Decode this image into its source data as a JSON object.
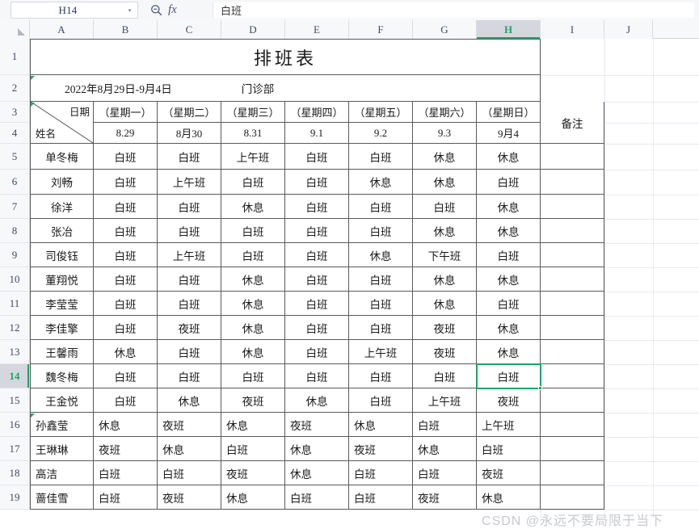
{
  "app": {
    "name_box_value": "H14",
    "name_box_caret": "▾",
    "fx_label": "fx",
    "formula_value": "白班",
    "search_icon": "magnifier-icon"
  },
  "grid": {
    "column_headers": [
      "A",
      "B",
      "C",
      "D",
      "E",
      "F",
      "G",
      "H",
      "I",
      "J"
    ],
    "active_column": "H",
    "row_headers": [
      "1",
      "2",
      "3",
      "4",
      "5",
      "6",
      "7",
      "8",
      "9",
      "10",
      "11",
      "12",
      "13",
      "14",
      "15",
      "16",
      "17",
      "18",
      "19"
    ],
    "active_row": "14"
  },
  "sheet": {
    "title": "排班表",
    "period": "2022年8月29日-9月4日",
    "department": "门诊部",
    "corner_date_label": "日期",
    "corner_name_label": "姓名",
    "remarks_header": "备注",
    "day_names": [
      "（星期一）",
      "（星期二）",
      "（星期三）",
      "（星期四）",
      "（星期五）",
      "（星期六）",
      "（星期日）"
    ],
    "day_dates": [
      "8.29",
      "8月30",
      "8.31",
      "9.1",
      "9.2",
      "9.3",
      "9月4"
    ],
    "rows": [
      {
        "row": "5",
        "name": "单冬梅",
        "shifts": [
          "白班",
          "白班",
          "上午班",
          "白班",
          "白班",
          "休息",
          "休息"
        ],
        "remark": ""
      },
      {
        "row": "6",
        "name": "刘畅",
        "shifts": [
          "白班",
          "上午班",
          "白班",
          "白班",
          "休息",
          "休息",
          "白班"
        ],
        "remark": ""
      },
      {
        "row": "7",
        "name": "徐洋",
        "shifts": [
          "白班",
          "白班",
          "休息",
          "白班",
          "白班",
          "白班",
          "休息"
        ],
        "remark": ""
      },
      {
        "row": "8",
        "name": "张冶",
        "shifts": [
          "白班",
          "白班",
          "白班",
          "白班",
          "白班",
          "休息",
          "休息"
        ],
        "remark": ""
      },
      {
        "row": "9",
        "name": "司俊钰",
        "shifts": [
          "白班",
          "上午班",
          "白班",
          "白班",
          "休息",
          "下午班",
          "白班"
        ],
        "remark": ""
      },
      {
        "row": "10",
        "name": "董翔悦",
        "shifts": [
          "白班",
          "白班",
          "休息",
          "白班",
          "白班",
          "休息",
          "休息"
        ],
        "remark": ""
      },
      {
        "row": "11",
        "name": "李莹莹",
        "shifts": [
          "白班",
          "白班",
          "休息",
          "白班",
          "白班",
          "休息",
          "白班"
        ],
        "remark": ""
      },
      {
        "row": "12",
        "name": "李佳擎",
        "shifts": [
          "白班",
          "夜班",
          "休息",
          "白班",
          "白班",
          "夜班",
          "休息"
        ],
        "remark": ""
      },
      {
        "row": "13",
        "name": "王馨雨",
        "shifts": [
          "休息",
          "白班",
          "休息",
          "白班",
          "上午班",
          "夜班",
          "休息"
        ],
        "remark": ""
      },
      {
        "row": "14",
        "name": "魏冬梅",
        "shifts": [
          "白班",
          "白班",
          "白班",
          "白班",
          "白班",
          "白班",
          "白班"
        ],
        "remark": ""
      },
      {
        "row": "15",
        "name": "王金悦",
        "shifts": [
          "白班",
          "休息",
          "夜班",
          "休息",
          "白班",
          "上午班",
          "夜班"
        ],
        "remark": ""
      },
      {
        "row": "16",
        "name": "孙鑫莹",
        "shifts": [
          "休息",
          "夜班",
          "休息",
          "夜班",
          "休息",
          "白班",
          "上午班"
        ],
        "remark": ""
      },
      {
        "row": "17",
        "name": "王琳琳",
        "shifts": [
          "夜班",
          "休息",
          "白班",
          "休息",
          "夜班",
          "休息",
          "白班"
        ],
        "remark": ""
      },
      {
        "row": "18",
        "name": "高洁",
        "shifts": [
          "白班",
          "白班",
          "夜班",
          "休息",
          "白班",
          "白班",
          "夜班"
        ],
        "remark": ""
      },
      {
        "row": "19",
        "name": "蔷佳雪",
        "shifts": [
          "白班",
          "夜班",
          "休息",
          "白班",
          "白班",
          "夜班",
          "休息"
        ],
        "remark": ""
      }
    ]
  },
  "watermark": {
    "text": "CSDN @永远不要局限于当下"
  },
  "colors": {
    "accent_green": "#21a366",
    "header_bg": "#f7f8fa",
    "active_header_bg": "#d4d7de",
    "table_border": "#5a5a5a",
    "grid_line": "#e7eaf2",
    "watermark": "#c6c9d0"
  }
}
